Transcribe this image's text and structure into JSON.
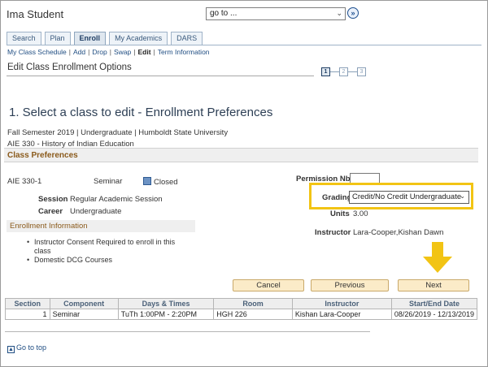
{
  "header": {
    "student_name": "Ima Student",
    "goto_value": "go to ..."
  },
  "tabs": [
    {
      "label": "Search"
    },
    {
      "label": "Plan"
    },
    {
      "label": "Enroll"
    },
    {
      "label": "My Academics"
    },
    {
      "label": "DARS"
    }
  ],
  "sublinks": [
    "My Class Schedule",
    "Add",
    "Drop",
    "Swap",
    "Edit",
    "Term Information"
  ],
  "section_title": "Edit Class Enrollment Options",
  "steps": [
    "1",
    "2",
    "3"
  ],
  "heading": "1.  Select a class to edit - Enrollment Preferences",
  "term_info": "Fall Semester 2019 | Undergraduate | Humboldt State University",
  "course_info": "AIE  330 - History of Indian Education",
  "class_prefs": {
    "title": "Class Preferences",
    "class_code": "AIE  330-1",
    "component": "Seminar",
    "status": "Closed",
    "session_label": "Session",
    "session_value": "Regular Academic Session",
    "career_label": "Career",
    "career_value": "Undergraduate",
    "permission_label": "Permission Nbr",
    "permission_value": "",
    "grading_label": "Grading",
    "grading_value": "Credit/No Credit Undergraduate",
    "units_label": "Units",
    "units_value": "3.00",
    "instructor_label": "Instructor",
    "instructor_value": "Lara-Cooper,Kishan Dawn"
  },
  "enrollment_info": {
    "title": "Enrollment Information",
    "items": [
      "Instructor Consent Required to enroll in this class",
      "Domestic DCG Courses"
    ]
  },
  "buttons": {
    "cancel": "Cancel",
    "previous": "Previous",
    "next": "Next"
  },
  "table": {
    "headers": [
      "Section",
      "Component",
      "Days & Times",
      "Room",
      "Instructor",
      "Start/End Date"
    ],
    "rows": [
      [
        "1",
        "Seminar",
        "TuTh 1:00PM - 2:20PM",
        "HGH 226",
        "Kishan Lara-Cooper",
        "08/26/2019 - 12/13/2019"
      ]
    ]
  },
  "footer": {
    "go_to_top": "Go to top"
  },
  "colors": {
    "highlight": "#f2c414",
    "arrow": "#f2c414",
    "button_bg": "#fbebc8",
    "section_text": "#8a5a1b"
  }
}
